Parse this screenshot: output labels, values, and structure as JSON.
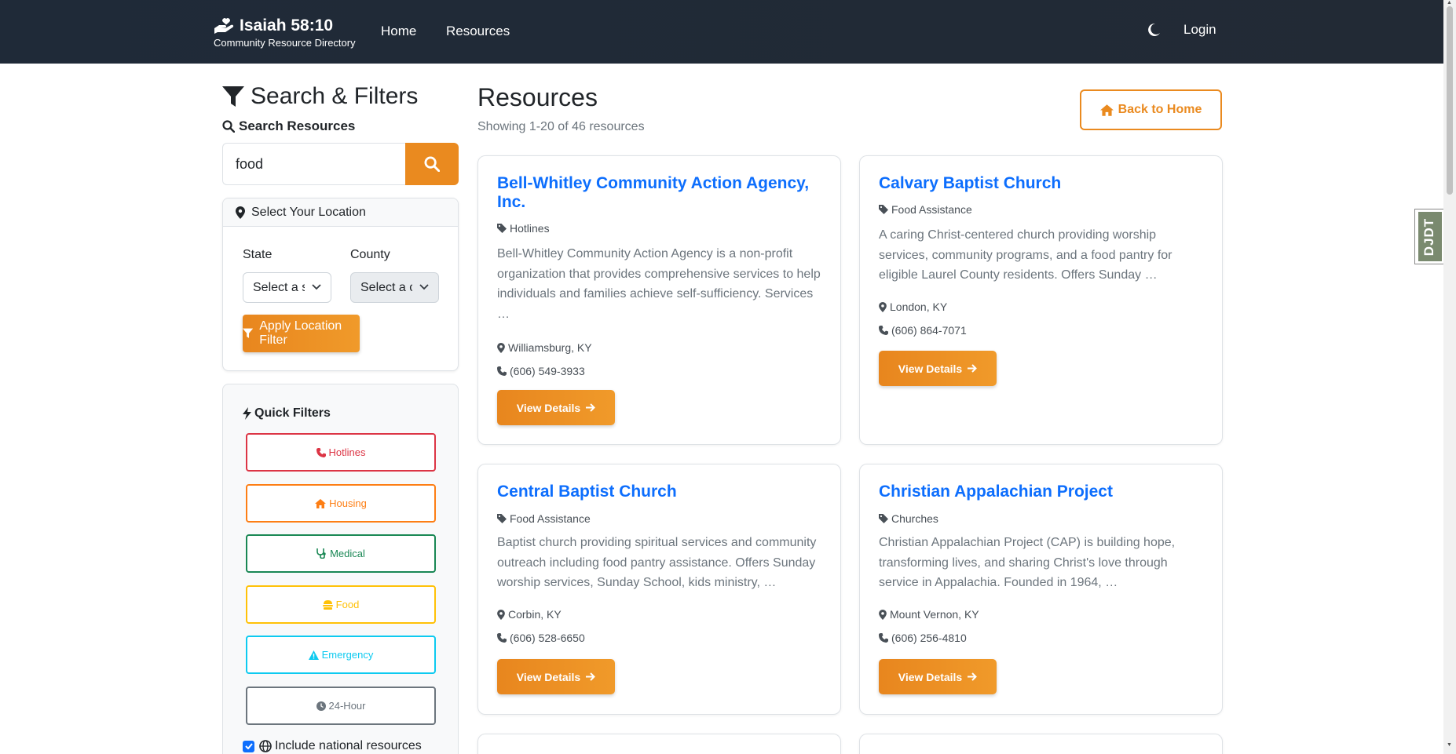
{
  "nav": {
    "brand_title": "Isaiah 58:10",
    "brand_subtitle": "Community Resource Directory",
    "home": "Home",
    "resources": "Resources",
    "login": "Login"
  },
  "sidebar": {
    "title": "Search & Filters",
    "search_label": "Search Resources",
    "search_value": "food",
    "location_header": "Select Your Location",
    "state_label": "State",
    "county_label": "County",
    "state_value": "Select a state",
    "county_value": "Select a county",
    "apply_label": "Apply Location Filter",
    "quick_title": "Quick Filters",
    "quick_filters": [
      "Hotlines",
      "Housing",
      "Medical",
      "Food",
      "Emergency",
      "24-Hour"
    ],
    "national_label": "Include national resources",
    "national_checked": true
  },
  "main": {
    "title": "Resources",
    "showing": "Showing 1-20 of 46 resources",
    "back_label": "Back to Home",
    "view_label": "View Details"
  },
  "cards": [
    {
      "title": "Bell-Whitley Community Action Agency, Inc.",
      "category": "Hotlines",
      "description": "Bell-Whitley Community Action Agency is a non-profit organization that provides comprehensive services to help individuals and families achieve self-sufficiency. Services …",
      "location": "Williamsburg, KY",
      "phone": "(606) 549-3933"
    },
    {
      "title": "Calvary Baptist Church",
      "category": "Food Assistance",
      "description": "A caring Christ-centered church providing worship services, community programs, and a food pantry for eligible Laurel County residents. Offers Sunday …",
      "location": "London, KY",
      "phone": "(606) 864-7071"
    },
    {
      "title": "Central Baptist Church",
      "category": "Food Assistance",
      "description": "Baptist church providing spiritual services and community outreach including food pantry assistance. Offers Sunday worship services, Sunday School, kids ministry, …",
      "location": "Corbin, KY",
      "phone": "(606) 528-6650"
    },
    {
      "title": "Christian Appalachian Project",
      "category": "Churches",
      "description": "Christian Appalachian Project (CAP) is building hope, transforming lives, and sharing Christ's love through service in Appalachia. Founded in 1964, …",
      "location": "Mount Vernon, KY",
      "phone": "(606) 256-4810"
    }
  ],
  "devtools": {
    "label": "DJDT"
  },
  "colors": {
    "accent": "#ea8a1f",
    "link": "#0d6efd",
    "navbar": "#1f2a38"
  }
}
